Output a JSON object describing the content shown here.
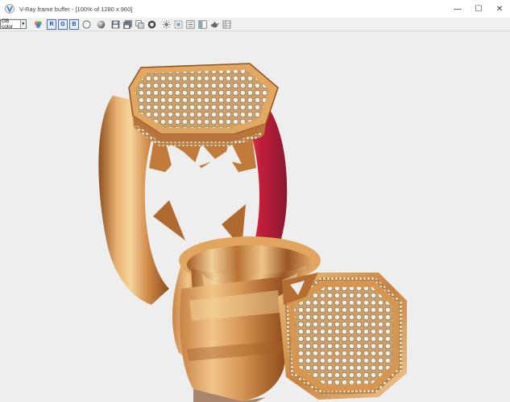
{
  "window": {
    "title": "V-Ray frame buffer - [100% of 1280 x 960]",
    "minimize_glyph": "—",
    "maximize_glyph": "☐",
    "close_glyph": "✕"
  },
  "toolbar": {
    "channel_select_value": "GB color",
    "channel_buttons": [
      {
        "label": "R"
      },
      {
        "label": "G"
      },
      {
        "label": "B"
      }
    ],
    "icons": [
      "mono-circle-icon",
      "sphere-icon",
      "save-icon",
      "save-all-icon",
      "clone-icon",
      "clear-icon",
      "color-picker-icon",
      "lens-effects-icon",
      "region-icon",
      "history-icon",
      "compare-icon",
      "teapot-icon",
      "layers-icon"
    ]
  },
  "viewport": {
    "background": "#eeeeee",
    "content": "render-image",
    "gold_highlight": "#f3c98a",
    "gold_mid": "#d89650",
    "gold_dark": "#9b5a24",
    "red_reflection": "#c21e3a"
  }
}
